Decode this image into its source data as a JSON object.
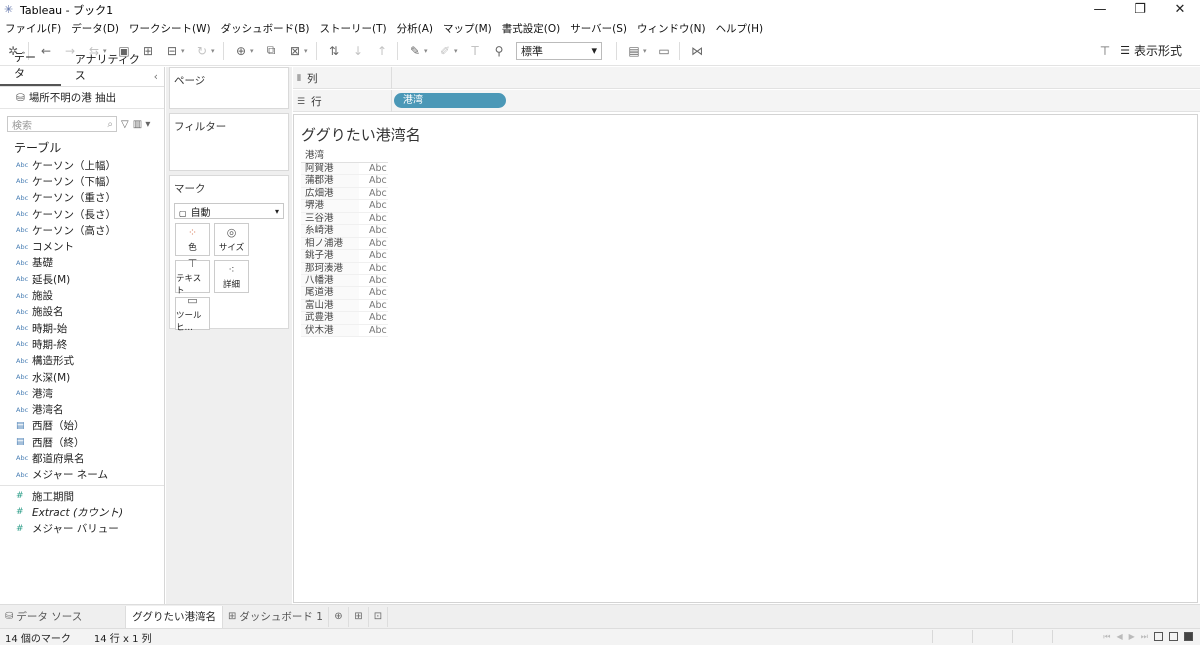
{
  "window": {
    "title": "Tableau - ブック1",
    "controls": [
      "—",
      "❐",
      "✕"
    ]
  },
  "menu": [
    "ファイル(F)",
    "データ(D)",
    "ワークシート(W)",
    "ダッシュボード(B)",
    "ストーリー(T)",
    "分析(A)",
    "マップ(M)",
    "書式設定(O)",
    "サーバー(S)",
    "ウィンドウ(N)",
    "ヘルプ(H)"
  ],
  "toolbar": {
    "fit_value": "標準",
    "show_me_label": "表示形式"
  },
  "left_pane": {
    "tabs": [
      "データ",
      "アナリティクス"
    ],
    "datasource_name": "場所不明の港 抽出",
    "search_placeholder": "検索",
    "tables_heading": "テーブル",
    "dimensions": [
      {
        "type": "Abc",
        "name": "ケーソン（上幅）"
      },
      {
        "type": "Abc",
        "name": "ケーソン（下幅）"
      },
      {
        "type": "Abc",
        "name": "ケーソン（重さ）"
      },
      {
        "type": "Abc",
        "name": "ケーソン（長さ）"
      },
      {
        "type": "Abc",
        "name": "ケーソン（高さ）"
      },
      {
        "type": "Abc",
        "name": "コメント"
      },
      {
        "type": "Abc",
        "name": "基礎"
      },
      {
        "type": "Abc",
        "name": "延長(M)"
      },
      {
        "type": "Abc",
        "name": "施設"
      },
      {
        "type": "Abc",
        "name": "施設名"
      },
      {
        "type": "Abc",
        "name": "時期-始"
      },
      {
        "type": "Abc",
        "name": "時期-終"
      },
      {
        "type": "Abc",
        "name": "構造形式"
      },
      {
        "type": "Abc",
        "name": "水深(M)"
      },
      {
        "type": "Abc",
        "name": "港湾"
      },
      {
        "type": "Abc",
        "name": "港湾名"
      },
      {
        "type": "date",
        "name": "西暦（始）"
      },
      {
        "type": "date",
        "name": "西暦（終）"
      },
      {
        "type": "Abc",
        "name": "都道府県名"
      },
      {
        "type": "Abc",
        "name": "メジャー ネーム"
      }
    ],
    "measures": [
      {
        "type": "#",
        "name": "施工期間"
      },
      {
        "type": "#",
        "name": "Extract (カウント)"
      },
      {
        "type": "#",
        "name": "メジャー バリュー"
      }
    ]
  },
  "cards": {
    "pages_title": "ページ",
    "filters_title": "フィルター",
    "marks_title": "マーク",
    "mark_type": "自動",
    "mark_buttons": [
      {
        "icon": "color-icon",
        "label": "色"
      },
      {
        "icon": "size-icon",
        "label": "サイズ"
      },
      {
        "icon": "text-icon",
        "label": "テキスト"
      },
      {
        "icon": "detail-icon",
        "label": "詳細"
      },
      {
        "icon": "tooltip-icon",
        "label": "ツールヒ…"
      }
    ]
  },
  "shelves": {
    "columns_label": "列",
    "rows_label": "行",
    "rows_pill": "港湾"
  },
  "view": {
    "title": "ググりたい港湾名",
    "header": "港湾",
    "rows": [
      "阿賀港",
      "蒲郡港",
      "広畑港",
      "堺港",
      "三谷港",
      "糸崎港",
      "相ノ浦港",
      "銚子港",
      "那珂湊港",
      "八幡港",
      "尾道港",
      "富山港",
      "武豊港",
      "伏木港"
    ],
    "cell_value": "Abc"
  },
  "sheet_tabs": {
    "datasource": "データ ソース",
    "sheets": [
      "ググりたい港湾名",
      "ダッシュボード 1"
    ]
  },
  "status": {
    "marks": "14 個のマーク",
    "dims": "14 行 x 1 列"
  }
}
